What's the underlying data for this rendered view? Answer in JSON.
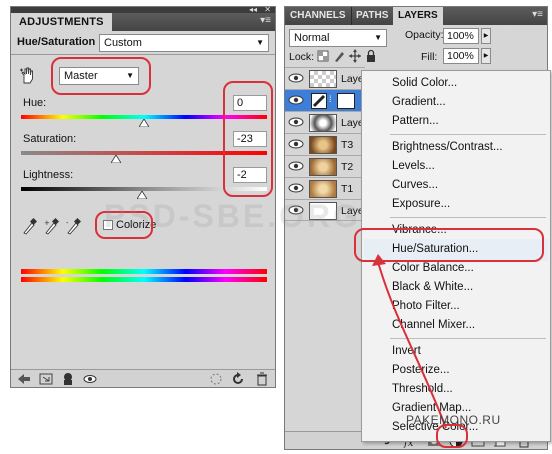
{
  "adjustments": {
    "tab_label": "ADJUSTMENTS",
    "title": "Hue/Saturation",
    "preset": "Custom",
    "channel": "Master",
    "hue": {
      "label": "Hue:",
      "value": "0"
    },
    "saturation": {
      "label": "Saturation:",
      "value": "-23"
    },
    "lightness": {
      "label": "Lightness:",
      "value": "-2"
    },
    "colorize_label": "Colorize",
    "colorize_checked": false
  },
  "layers": {
    "tabs": [
      "CHANNELS",
      "PATHS",
      "LAYERS"
    ],
    "active_tab": "LAYERS",
    "blend_mode": "Normal",
    "opacity_label": "Opacity:",
    "opacity_value": "100%",
    "lock_label": "Lock:",
    "fill_label": "Fill:",
    "fill_value": "100%",
    "rows": [
      {
        "name": "Laye"
      },
      {
        "name": ""
      },
      {
        "name": "Laye"
      },
      {
        "name": "T3"
      },
      {
        "name": "T2"
      },
      {
        "name": "T1"
      },
      {
        "name": "Laye"
      }
    ]
  },
  "menu": {
    "groups": [
      [
        "Solid Color...",
        "Gradient...",
        "Pattern..."
      ],
      [
        "Brightness/Contrast...",
        "Levels...",
        "Curves...",
        "Exposure..."
      ],
      [
        "Vibrance...",
        "Hue/Saturation...",
        "Color Balance...",
        "Black & White...",
        "Photo Filter...",
        "Channel Mixer..."
      ],
      [
        "Invert",
        "Posterize...",
        "Threshold...",
        "Gradient Map...",
        "Selective Color..."
      ]
    ],
    "highlighted": "Hue/Saturation..."
  },
  "watermark_site": "PAKEMONO.RU",
  "colors": {
    "annotation": "#d9303a",
    "panel_bg": "#d6d6d6",
    "menu_bg": "#f2f2f2",
    "selected_row": "#3d7fd8"
  }
}
